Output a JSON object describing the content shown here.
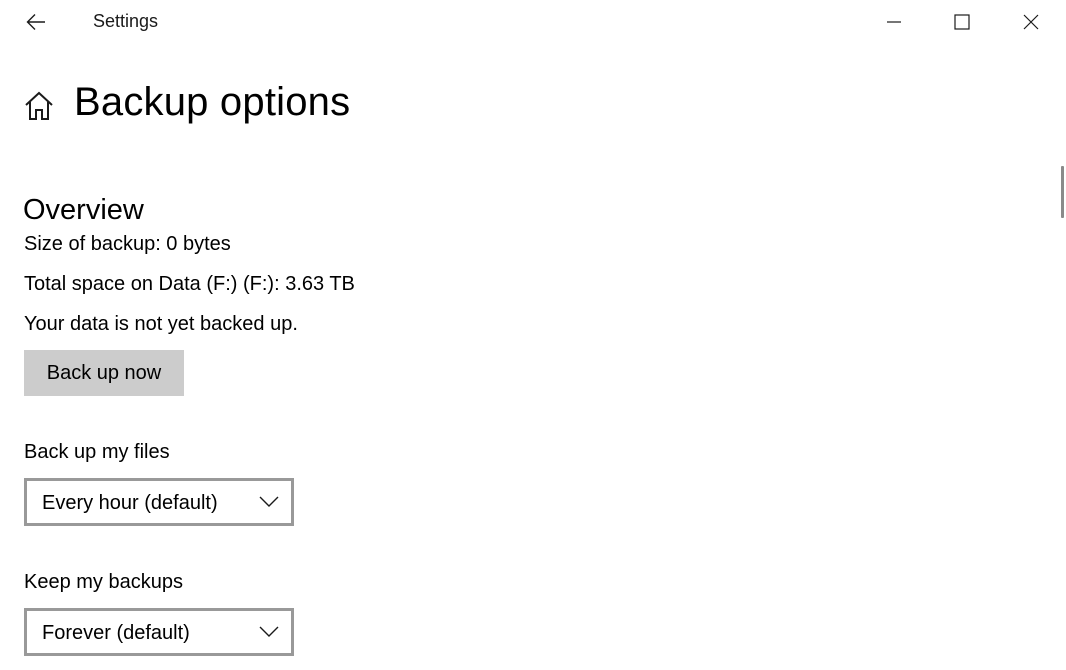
{
  "window": {
    "title": "Settings"
  },
  "header": {
    "page_title": "Backup options"
  },
  "overview": {
    "section_title": "Overview",
    "size_of_backup": "Size of backup: 0 bytes",
    "total_space": "Total space on Data (F:) (F:): 3.63 TB",
    "status": "Your data is not yet backed up.",
    "back_up_now_label": "Back up now"
  },
  "backup_frequency": {
    "label": "Back up my files",
    "selected": "Every hour (default)"
  },
  "keep_backups": {
    "label": "Keep my backups",
    "selected": "Forever (default)"
  },
  "icons": {
    "back": "back-arrow-icon",
    "home": "home-icon",
    "minimize": "minimize-icon",
    "maximize": "maximize-icon",
    "close": "close-icon",
    "chevron": "chevron-down-icon"
  },
  "colors": {
    "button_background": "#cccccc",
    "dropdown_border": "#999999",
    "scrollbar_thumb": "#8a8a8a"
  }
}
